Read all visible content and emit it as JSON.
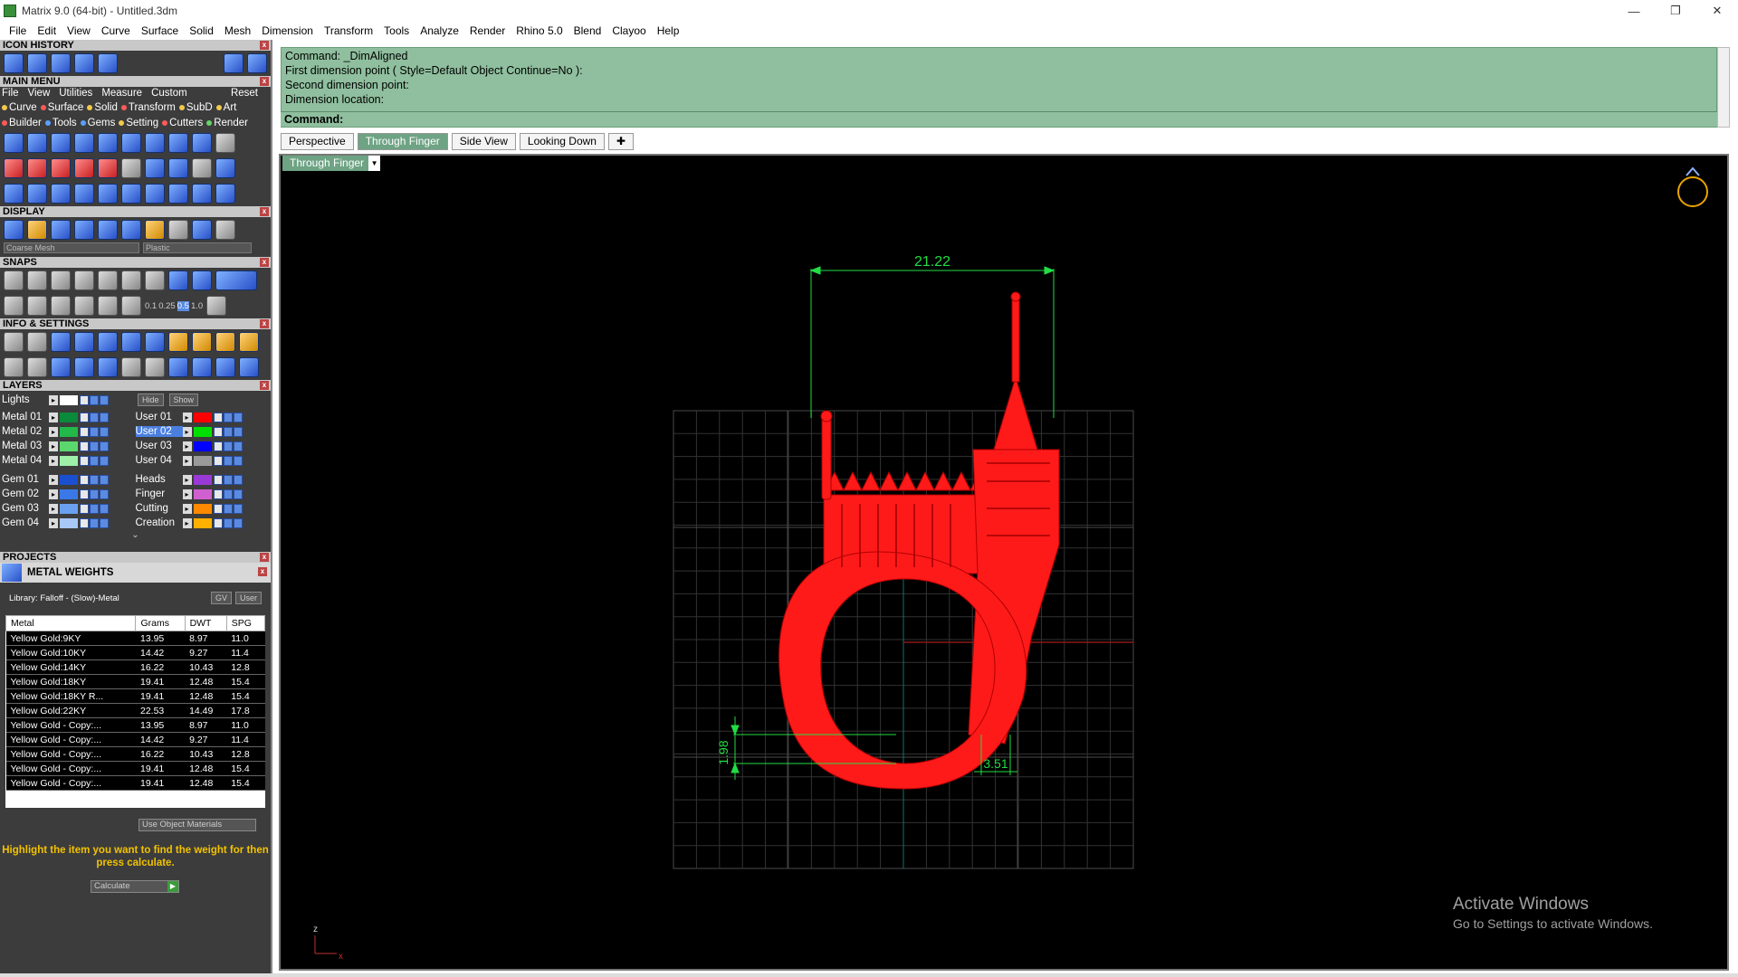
{
  "window": {
    "title": "Matrix 9.0 (64-bit) - Untitled.3dm"
  },
  "menubar": [
    "File",
    "Edit",
    "View",
    "Curve",
    "Surface",
    "Solid",
    "Mesh",
    "Dimension",
    "Transform",
    "Tools",
    "Analyze",
    "Render",
    "Rhino 5.0",
    "Blend",
    "Clayoo",
    "Help"
  ],
  "left": {
    "icon_history": "ICON HISTORY",
    "main_menu": "MAIN MENU",
    "main_menu_items": [
      "File",
      "View",
      "Utilities",
      "Measure",
      "Custom"
    ],
    "reset": "Reset",
    "cat_row1": [
      "Curve",
      "Surface",
      "Solid",
      "Transform",
      "SubD",
      "Art"
    ],
    "cat_row2": [
      "Builder",
      "Tools",
      "Gems",
      "Setting",
      "Cutters",
      "Render"
    ],
    "display": "DISPLAY",
    "display_mesh": "Coarse Mesh",
    "display_material": "Plastic",
    "snaps": "SNAPS",
    "snap_values": [
      "0.1",
      "0.25",
      "0.5",
      "1.0"
    ],
    "info": "INFO & SETTINGS",
    "layers_title": "LAYERS",
    "lights": "Lights",
    "hide": "Hide",
    "show": "Show",
    "layers_left": [
      "Metal 01",
      "Metal 02",
      "Metal 03",
      "Metal 04",
      "Gem 01",
      "Gem 02",
      "Gem 03",
      "Gem 04"
    ],
    "layers_right": [
      "User 01",
      "User 02",
      "User 03",
      "User 04",
      "Heads",
      "Finger",
      "Cutting",
      "Creation"
    ],
    "projects": "PROJECTS",
    "metal_weights": "METAL WEIGHTS",
    "library": "Library: Falloff - (Slow)-Metal",
    "gv": "GV",
    "user": "User",
    "table": {
      "headers": [
        "Metal",
        "Grams",
        "DWT",
        "SPG"
      ],
      "rows": [
        [
          "Yellow Gold:9KY",
          "13.95",
          "8.97",
          "11.0"
        ],
        [
          "Yellow Gold:10KY",
          "14.42",
          "9.27",
          "11.4"
        ],
        [
          "Yellow Gold:14KY",
          "16.22",
          "10.43",
          "12.8"
        ],
        [
          "Yellow Gold:18KY",
          "19.41",
          "12.48",
          "15.4"
        ],
        [
          "Yellow Gold:18KY R...",
          "19.41",
          "12.48",
          "15.4"
        ],
        [
          "Yellow Gold:22KY",
          "22.53",
          "14.49",
          "17.8"
        ],
        [
          "Yellow Gold - Copy:...",
          "13.95",
          "8.97",
          "11.0"
        ],
        [
          "Yellow Gold - Copy:...",
          "14.42",
          "9.27",
          "11.4"
        ],
        [
          "Yellow Gold - Copy:...",
          "16.22",
          "10.43",
          "12.8"
        ],
        [
          "Yellow Gold - Copy:...",
          "19.41",
          "12.48",
          "15.4"
        ],
        [
          "Yellow Gold - Copy:...",
          "19.41",
          "12.48",
          "15.4"
        ]
      ]
    },
    "use_object_materials": "Use Object Materials",
    "hint": "Highlight the item you want to find the weight for then press calculate.",
    "calculate": "Calculate"
  },
  "command": {
    "lines": [
      "Command: _DimAligned",
      "First dimension point ( Style=Default  Object  Continue=No ):",
      "Second dimension point:",
      "Dimension location:"
    ],
    "prompt": "Command:"
  },
  "tabs": [
    "Perspective",
    "Through Finger",
    "Side View",
    "Looking Down"
  ],
  "viewport": {
    "name": "Through Finger",
    "dim_width": "21.22",
    "dim_height": "1.98",
    "dim_small": "3.51",
    "axis_label_z": "z",
    "axis_label_x": "x"
  },
  "watermark": {
    "line1": "Activate Windows",
    "line2": "Go to Settings to activate Windows."
  },
  "colors": {
    "ring": "#ff1a1a",
    "dimension": "#22dd44",
    "grid": "#3a3a3a",
    "command_bg": "#8fbf9e"
  }
}
